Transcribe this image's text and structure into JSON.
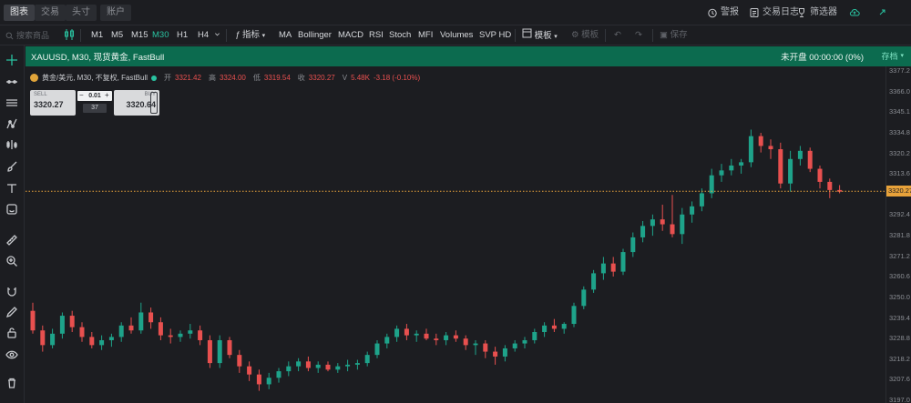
{
  "top_tabs": [
    "图表",
    "交易",
    "头寸",
    "账户"
  ],
  "top_right": [
    {
      "icon": "alarm-clock-icon",
      "label": "警报"
    },
    {
      "icon": "notes-icon",
      "label": "交易日志"
    },
    {
      "icon": "trophy-icon",
      "label": "筛选器"
    }
  ],
  "toolbar": {
    "search_placeholder": "搜索商品",
    "timeframes": [
      "M1",
      "M5",
      "M15",
      "M30",
      "H1",
      "H4"
    ],
    "active_timeframe": "M30",
    "indicators_label": "指标",
    "indicators": [
      "MA",
      "Bollinger",
      "MACD",
      "RSI",
      "Stoch",
      "MFI",
      "Volumes",
      "SVP HD"
    ],
    "layout_label": "模板",
    "template_label": "模板",
    "save_label": "保存"
  },
  "symbol": {
    "title": "XAUUSD, M30, 现货黄金, FastBull",
    "timer": "未开盘 00:00:00 (0%)",
    "right_button": "存档"
  },
  "ohlc": {
    "name": "黄金/美元, M30, 不复权, FastBull",
    "open_label": "开",
    "open": "3321.42",
    "high_label": "高",
    "high": "3324.00",
    "low_label": "低",
    "low": "3319.54",
    "close_label": "收",
    "close": "3320.27",
    "volume_label": "V",
    "volume": "5.48K",
    "change": "-3.18 (-0.10%)"
  },
  "trade": {
    "sell_label": "SELL",
    "sell_price": "3320.27",
    "buy_label": "BUY",
    "buy_price": "3320.64",
    "qty": "0.01",
    "spread": "37"
  },
  "y_axis": {
    "labels": [
      "3377.2",
      "3366.0",
      "3345.1",
      "3334.8",
      "3320.2",
      "3313.6",
      "3303.3",
      "3292.4",
      "3281.8",
      "3271.2",
      "3260.6",
      "3250.0",
      "3239.4",
      "3228.8",
      "3218.2",
      "3207.6",
      "3197.0"
    ],
    "current_price": "3320.27"
  },
  "colors": {
    "up": "#1ea38a",
    "down": "#e8504f",
    "accent": "#29c2a0",
    "header": "#0c6b4f",
    "price_line": "#e8a23a"
  },
  "chart_data": {
    "type": "candlestick",
    "ylim": [
      3195,
      3380
    ],
    "current_price": 3320.27,
    "candles": [
      [
        3247,
        3252,
        3233,
        3235
      ],
      [
        3235,
        3238,
        3222,
        3226
      ],
      [
        3226,
        3236,
        3224,
        3233
      ],
      [
        3233,
        3246,
        3230,
        3244
      ],
      [
        3244,
        3247,
        3234,
        3237
      ],
      [
        3237,
        3240,
        3228,
        3231
      ],
      [
        3231,
        3234,
        3224,
        3226
      ],
      [
        3226,
        3232,
        3223,
        3229
      ],
      [
        3229,
        3233,
        3225,
        3231
      ],
      [
        3231,
        3240,
        3228,
        3238
      ],
      [
        3238,
        3243,
        3233,
        3235
      ],
      [
        3235,
        3252,
        3233,
        3246
      ],
      [
        3246,
        3249,
        3236,
        3240
      ],
      [
        3240,
        3243,
        3229,
        3232
      ],
      [
        3232,
        3236,
        3227,
        3231
      ],
      [
        3231,
        3235,
        3228,
        3233
      ],
      [
        3233,
        3239,
        3230,
        3235
      ],
      [
        3235,
        3238,
        3226,
        3229
      ],
      [
        3229,
        3232,
        3212,
        3215
      ],
      [
        3215,
        3232,
        3212,
        3229
      ],
      [
        3229,
        3231,
        3218,
        3220
      ],
      [
        3220,
        3223,
        3209,
        3213
      ],
      [
        3213,
        3216,
        3204,
        3208
      ],
      [
        3208,
        3211,
        3198,
        3202
      ],
      [
        3202,
        3209,
        3199,
        3206
      ],
      [
        3206,
        3212,
        3203,
        3210
      ],
      [
        3210,
        3216,
        3207,
        3213
      ],
      [
        3213,
        3218,
        3210,
        3216
      ],
      [
        3216,
        3219,
        3210,
        3212
      ],
      [
        3212,
        3216,
        3209,
        3214
      ],
      [
        3214,
        3216,
        3210,
        3211
      ],
      [
        3211,
        3215,
        3209,
        3213
      ],
      [
        3213,
        3217,
        3210,
        3214
      ],
      [
        3214,
        3217,
        3211,
        3215
      ],
      [
        3215,
        3222,
        3213,
        3220
      ],
      [
        3220,
        3229,
        3218,
        3227
      ],
      [
        3227,
        3233,
        3224,
        3231
      ],
      [
        3231,
        3238,
        3228,
        3236
      ],
      [
        3236,
        3239,
        3229,
        3232
      ],
      [
        3232,
        3235,
        3228,
        3233
      ],
      [
        3233,
        3236,
        3229,
        3230
      ],
      [
        3230,
        3233,
        3226,
        3229
      ],
      [
        3229,
        3234,
        3226,
        3232
      ],
      [
        3232,
        3235,
        3228,
        3230
      ],
      [
        3230,
        3232,
        3223,
        3226
      ],
      [
        3226,
        3229,
        3220,
        3227
      ],
      [
        3227,
        3229,
        3218,
        3222
      ],
      [
        3222,
        3225,
        3214,
        3219
      ],
      [
        3219,
        3226,
        3216,
        3224
      ],
      [
        3224,
        3229,
        3222,
        3227
      ],
      [
        3227,
        3231,
        3224,
        3229
      ],
      [
        3229,
        3236,
        3227,
        3234
      ],
      [
        3234,
        3240,
        3231,
        3238
      ],
      [
        3238,
        3242,
        3234,
        3236
      ],
      [
        3236,
        3240,
        3233,
        3239
      ],
      [
        3239,
        3252,
        3237,
        3250
      ],
      [
        3250,
        3262,
        3248,
        3260
      ],
      [
        3260,
        3272,
        3258,
        3270
      ],
      [
        3270,
        3280,
        3266,
        3276
      ],
      [
        3276,
        3280,
        3268,
        3271
      ],
      [
        3271,
        3285,
        3269,
        3283
      ],
      [
        3283,
        3295,
        3280,
        3292
      ],
      [
        3292,
        3302,
        3289,
        3299
      ],
      [
        3299,
        3306,
        3293,
        3303
      ],
      [
        3303,
        3312,
        3296,
        3300
      ],
      [
        3300,
        3318,
        3292,
        3294
      ],
      [
        3294,
        3310,
        3288,
        3306
      ],
      [
        3306,
        3314,
        3301,
        3311
      ],
      [
        3311,
        3322,
        3308,
        3319
      ],
      [
        3319,
        3334,
        3316,
        3330
      ],
      [
        3330,
        3337,
        3326,
        3333
      ],
      [
        3333,
        3340,
        3330,
        3336
      ],
      [
        3336,
        3340,
        3331,
        3338
      ],
      [
        3338,
        3358,
        3335,
        3354
      ],
      [
        3354,
        3356,
        3344,
        3348
      ],
      [
        3348,
        3352,
        3340,
        3346
      ],
      [
        3346,
        3350,
        3322,
        3325
      ],
      [
        3325,
        3345,
        3320,
        3340
      ],
      [
        3340,
        3348,
        3336,
        3345
      ],
      [
        3345,
        3347,
        3332,
        3334
      ],
      [
        3334,
        3336,
        3322,
        3326
      ],
      [
        3326,
        3328,
        3316,
        3321
      ],
      [
        3321,
        3324,
        3319,
        3320
      ]
    ]
  }
}
